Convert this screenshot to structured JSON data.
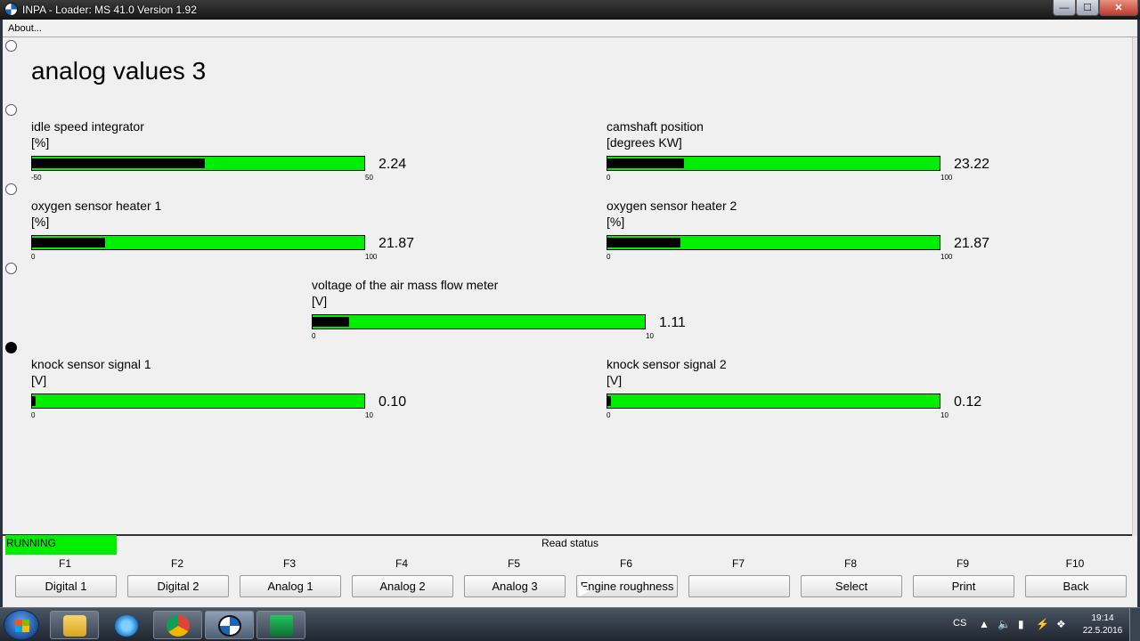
{
  "window": {
    "title": "INPA - Loader:  MS 41.0 Version 1.92",
    "controls": {
      "minimize": "—",
      "maximize": "☐",
      "close": "✕"
    }
  },
  "menu": {
    "about": "About..."
  },
  "page": {
    "title": "analog values 3"
  },
  "gauges": [
    {
      "label": "idle speed integrator",
      "unit": "[%]",
      "value": "2.24",
      "min": "-50",
      "max": "50",
      "level": 0.52
    },
    {
      "label": "camshaft position",
      "unit": "[degrees KW]",
      "value": "23.22",
      "min": "0",
      "max": "100",
      "level": 0.23
    },
    {
      "label": "oxygen sensor heater 1",
      "unit": "[%]",
      "value": "21.87",
      "min": "0",
      "max": "100",
      "level": 0.2187
    },
    {
      "label": "oxygen sensor heater 2",
      "unit": "[%]",
      "value": "21.87",
      "min": "0",
      "max": "100",
      "level": 0.2187
    },
    {
      "label": "voltage of the air mass flow meter",
      "unit": "[V]",
      "value": "1.11",
      "min": "0",
      "max": "10",
      "level": 0.111
    },
    {
      "label": "knock sensor signal 1",
      "unit": "[V]",
      "value": "0.10",
      "min": "0",
      "max": "10",
      "level": 0.01
    },
    {
      "label": "knock sensor signal 2",
      "unit": "[V]",
      "value": "0.12",
      "min": "0",
      "max": "10",
      "level": 0.012
    }
  ],
  "status": {
    "state": "RUNNING",
    "read_status": "Read status"
  },
  "fkeys": [
    {
      "key": "F1",
      "label": "Digital 1"
    },
    {
      "key": "F2",
      "label": "Digital 2"
    },
    {
      "key": "F3",
      "label": "Analog 1"
    },
    {
      "key": "F4",
      "label": "Analog 2"
    },
    {
      "key": "F5",
      "label": "Analog 3"
    },
    {
      "key": "F6",
      "label": "Engine roughness"
    },
    {
      "key": "F7",
      "label": ""
    },
    {
      "key": "F8",
      "label": "Select"
    },
    {
      "key": "F9",
      "label": "Print"
    },
    {
      "key": "F10",
      "label": "Back"
    }
  ],
  "taskbar": {
    "apps": [
      "explorer-icon",
      "internet-explorer-icon",
      "chrome-icon",
      "bmw-icon",
      "ediabas-icon"
    ],
    "language": "CS",
    "time": "19:14",
    "date": "22.5.2016"
  },
  "colors": {
    "gauge_bg": "#00ee00",
    "gauge_fill": "#000000",
    "running": "#00ee00"
  }
}
